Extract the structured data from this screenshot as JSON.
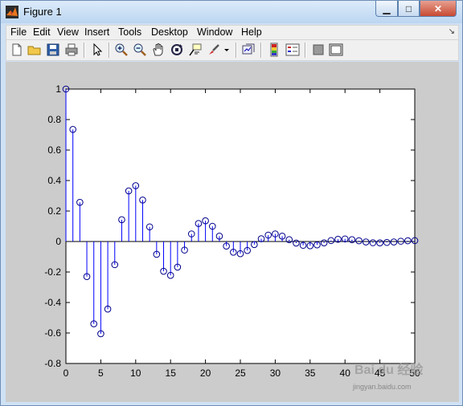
{
  "window": {
    "title": "Figure 1",
    "min_glyph": "▁",
    "max_glyph": "□",
    "close_glyph": "✕"
  },
  "menu": {
    "items": [
      "File",
      "Edit",
      "View",
      "Insert",
      "Tools",
      "Desktop",
      "Window",
      "Help"
    ],
    "overflow_glyph": "↘"
  },
  "toolbar": {
    "icons": [
      "new-figure-icon",
      "open-file-icon",
      "save-icon",
      "print-icon",
      "edit-plot-arrow-icon",
      "zoom-in-icon",
      "zoom-out-icon",
      "pan-hand-icon",
      "rotate-3d-icon",
      "data-cursor-icon",
      "brush-icon",
      "brush-dropdown-icon",
      "link-plot-icon",
      "colorbar-icon",
      "legend-icon",
      "hide-plot-tools-icon",
      "show-plot-tools-icon"
    ]
  },
  "colors": {
    "stem": "#0000ff",
    "marker": "#00008b",
    "axes_bg": "#ffffff",
    "figure_bg": "#cccccc"
  },
  "watermark": {
    "logo_text": "Bai du 经验",
    "url": "jingyan.baidu.com"
  },
  "chart_data": {
    "type": "stem",
    "x": [
      0,
      1,
      2,
      3,
      4,
      5,
      6,
      7,
      8,
      9,
      10,
      11,
      12,
      13,
      14,
      15,
      16,
      17,
      18,
      19,
      20,
      21,
      22,
      23,
      24,
      25,
      26,
      27,
      28,
      29,
      30,
      31,
      32,
      33,
      34,
      35,
      36,
      37,
      38,
      39,
      40,
      41,
      42,
      43,
      44,
      45,
      46,
      47,
      48,
      49,
      50
    ],
    "y": [
      1.0,
      0.735,
      0.257,
      -0.23,
      -0.54,
      -0.605,
      -0.443,
      -0.152,
      0.143,
      0.332,
      0.366,
      0.272,
      0.096,
      -0.084,
      -0.195,
      -0.222,
      -0.168,
      -0.056,
      0.05,
      0.118,
      0.136,
      0.1,
      0.035,
      -0.03,
      -0.07,
      -0.08,
      -0.059,
      -0.02,
      0.018,
      0.042,
      0.05,
      0.035,
      0.012,
      -0.01,
      -0.025,
      -0.028,
      -0.022,
      -0.009,
      0.006,
      0.015,
      0.017,
      0.012,
      0.005,
      -0.003,
      -0.008,
      -0.009,
      -0.006,
      -0.003,
      0.002,
      0.005,
      0.006
    ],
    "xlim": [
      0,
      50
    ],
    "ylim": [
      -0.8,
      1
    ],
    "xticks": [
      0,
      5,
      10,
      15,
      20,
      25,
      30,
      35,
      40,
      45,
      50
    ],
    "yticks": [
      -0.8,
      -0.6,
      -0.4,
      -0.2,
      0,
      0.2,
      0.4,
      0.6,
      0.8,
      1
    ],
    "xtick_labels": [
      "0",
      "5",
      "10",
      "15",
      "20",
      "25",
      "30",
      "35",
      "40",
      "45",
      "50"
    ],
    "ytick_labels": [
      "-0.8",
      "-0.6",
      "-0.4",
      "-0.2",
      "0",
      "0.2",
      "0.4",
      "0.6",
      "0.8",
      "1"
    ],
    "title": "",
    "xlabel": "",
    "ylabel": "",
    "grid": false,
    "marker": "circle-open"
  }
}
